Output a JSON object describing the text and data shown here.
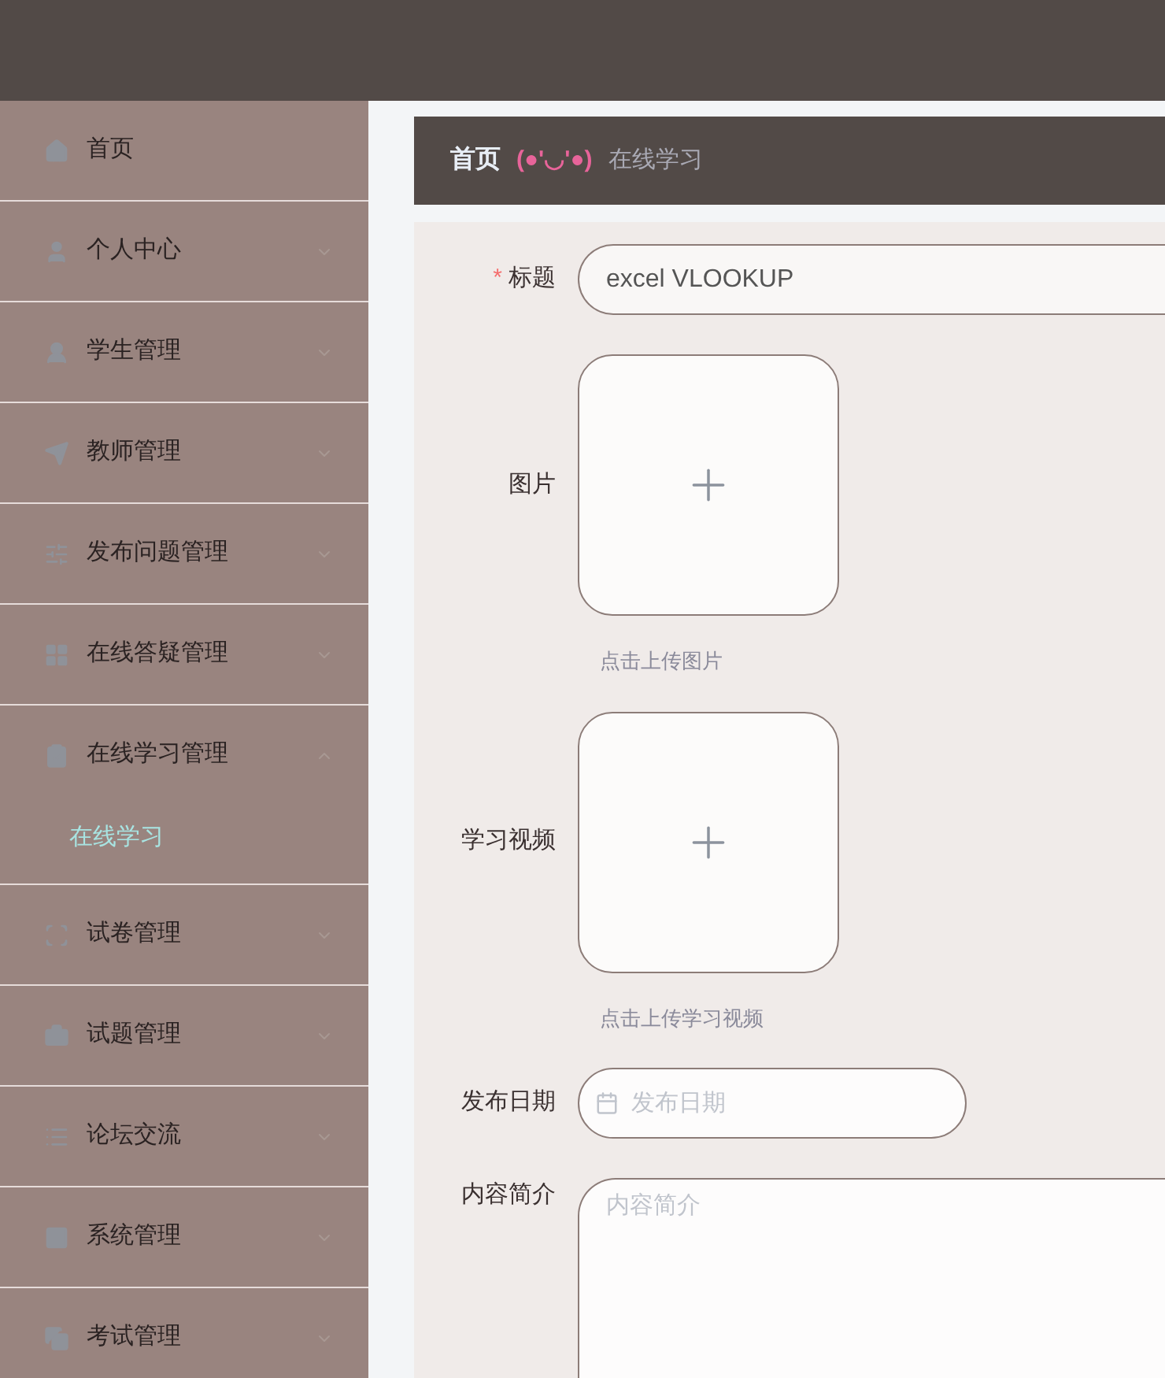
{
  "sidebar": {
    "items": [
      {
        "label": "首页",
        "kind": "link"
      },
      {
        "label": "个人中心",
        "kind": "submenu",
        "expanded": false
      },
      {
        "label": "学生管理",
        "kind": "submenu",
        "expanded": false
      },
      {
        "label": "教师管理",
        "kind": "submenu",
        "expanded": false
      },
      {
        "label": "发布问题管理",
        "kind": "submenu",
        "expanded": false
      },
      {
        "label": "在线答疑管理",
        "kind": "submenu",
        "expanded": false
      },
      {
        "label": "在线学习管理",
        "kind": "submenu",
        "expanded": true,
        "children": [
          {
            "label": "在线学习",
            "selected": true
          }
        ]
      },
      {
        "label": "试卷管理",
        "kind": "submenu",
        "expanded": false
      },
      {
        "label": "试题管理",
        "kind": "submenu",
        "expanded": false
      },
      {
        "label": "论坛交流",
        "kind": "submenu",
        "expanded": false
      },
      {
        "label": "系统管理",
        "kind": "submenu",
        "expanded": false
      },
      {
        "label": "考试管理",
        "kind": "submenu",
        "expanded": false
      }
    ]
  },
  "breadcrumb": {
    "home": "首页",
    "separator": "(●'◡'●)",
    "current": "在线学习"
  },
  "form": {
    "fields": [
      {
        "kind": "text",
        "label": "标题",
        "required_mark": "*",
        "value": "excel VLOOKUP"
      },
      {
        "kind": "upload",
        "label": "图片",
        "hint": "点击上传图片"
      },
      {
        "kind": "upload",
        "label": "学习视频",
        "hint": "点击上传学习视频"
      },
      {
        "kind": "date",
        "label": "发布日期",
        "placeholder": "发布日期"
      },
      {
        "kind": "textarea",
        "label": "内容简介",
        "placeholder": "内容简介"
      }
    ]
  }
}
